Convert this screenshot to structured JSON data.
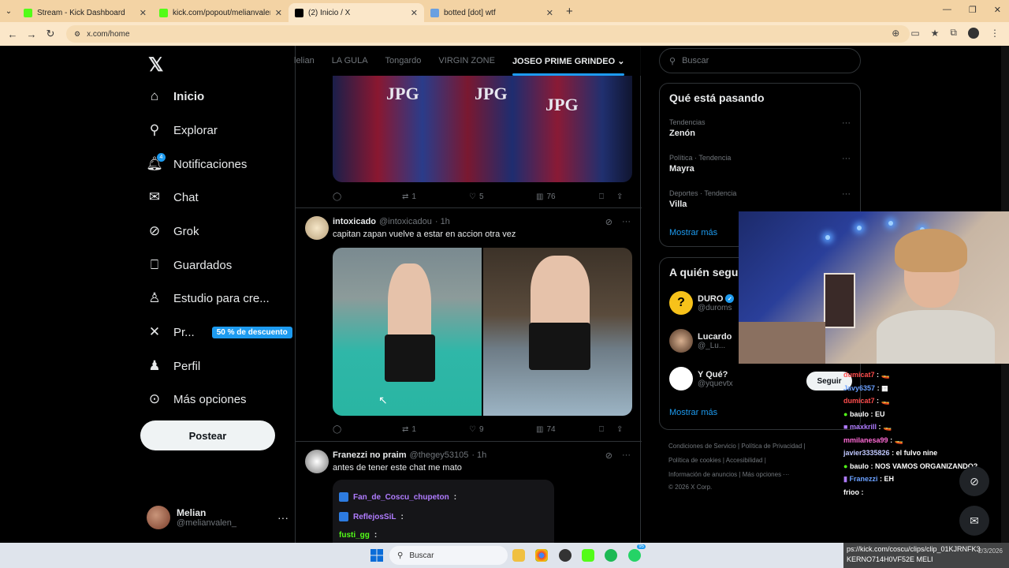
{
  "browser": {
    "tabs": [
      {
        "title": "Stream - Kick Dashboard",
        "favicon_color": "#53fc18"
      },
      {
        "title": "kick.com/popout/melianvalen/",
        "favicon_color": "#53fc18"
      },
      {
        "title": "(2) Inicio / X",
        "favicon_color": "#000000"
      },
      {
        "title": "botted [dot] wtf",
        "favicon_color": "#6aa0e0"
      }
    ],
    "new_tab": "+",
    "url": "x.com/home"
  },
  "nav": {
    "items": [
      {
        "label": "Inicio",
        "icon": "home-icon"
      },
      {
        "label": "Explorar",
        "icon": "search-icon"
      },
      {
        "label": "Notificaciones",
        "icon": "bell-icon",
        "badge": "4"
      },
      {
        "label": "Chat",
        "icon": "mail-icon"
      },
      {
        "label": "Grok",
        "icon": "grok-icon"
      },
      {
        "label": "Guardados",
        "icon": "bookmark-icon"
      },
      {
        "label": "Estudio para cre...",
        "icon": "studio-icon"
      },
      {
        "label": "Pr...",
        "icon": "x-premium-icon",
        "promo": "50 % de descuento"
      },
      {
        "label": "Perfil",
        "icon": "person-icon"
      },
      {
        "label": "Más opciones",
        "icon": "more-circle-icon"
      }
    ],
    "post_button": "Postear",
    "profile": {
      "name": "Melian",
      "handle": "@melianvalen_"
    }
  },
  "feed": {
    "tabs": [
      "lelian",
      "LA GULA",
      "Tongardo",
      "VIRGIN ZONE",
      "JOSEO PRIME GRINDEO"
    ],
    "active_tab": "JOSEO PRIME GRINDEO",
    "tweet0": {
      "image_text": "JPG",
      "replies": "",
      "retweets": "1",
      "likes": "5",
      "views": "76"
    },
    "tweet1": {
      "name": "intoxicado",
      "handle": "@intoxicadou",
      "time": "· 1h",
      "text": "capitan zapan vuelve a estar en accion otra vez",
      "retweets": "1",
      "likes": "9",
      "views": "74"
    },
    "tweet2": {
      "name": "Franezzi no praim",
      "handle": "@thegey53105",
      "time": "· 1h",
      "text": "antes de tener este chat me mato",
      "chat": [
        {
          "user": "Fan_de_Coscu_chupeton",
          "sep": ":",
          "color": "#b07cff"
        },
        {
          "user": "ReflejosSiL",
          "sep": ":",
          "color": "#b07cff"
        },
        {
          "user": "fusti_gg",
          "sep": ":",
          "color": "#53fc18"
        }
      ]
    }
  },
  "sidebar": {
    "search_placeholder": "Buscar",
    "trends_title": "Qué está pasando",
    "trends": [
      {
        "category": "Tendencias",
        "name": "Zenón"
      },
      {
        "category": "Política · Tendencia",
        "name": "Mayra"
      },
      {
        "category": "Deportes · Tendencia",
        "name": "Villa"
      }
    ],
    "show_more": "Mostrar más",
    "who_title": "A quién seguir",
    "who": [
      {
        "name": "DURO",
        "handle": "@duroms",
        "verified": true
      },
      {
        "name": "Lucardo",
        "handle": "@_Lu..."
      },
      {
        "name": "Y Qué?",
        "handle": "@yquevtx"
      }
    ],
    "follow_label": "Seguir",
    "who_more": "Mostrar más",
    "footer": [
      "Condiciones de Servicio",
      "Política de Privacidad",
      "Política de cookies",
      "Accesibilidad",
      "Información de anuncios",
      "Más opciones ···",
      "© 2026 X Corp."
    ]
  },
  "stream_chat": [
    {
      "user": "dumicat7",
      "msg": ":",
      "color": "#ff4d4d"
    },
    {
      "user": "Javy6357",
      "msg": ":",
      "color": "#6aa0ff"
    },
    {
      "user": "dumicat7",
      "msg": ":",
      "color": "#ff4d4d"
    },
    {
      "user": "baulo",
      "msg": ": EU",
      "color": "#ffffff"
    },
    {
      "user": "maxkrill",
      "msg": ":",
      "color": "#b07cff"
    },
    {
      "user": "mmilanesa99",
      "msg": ":",
      "color": "#ff6ad5"
    },
    {
      "user": "javier3335826",
      "msg": ": el fulvo nine",
      "color": "#c0c8ff"
    },
    {
      "user": "baulo",
      "msg": ": NOS VAMOS ORGANIZANDO?",
      "color": "#ffffff"
    },
    {
      "user": "Franezzi",
      "msg": ": EH",
      "color": "#6aa0ff"
    },
    {
      "user": "frioo",
      "msg": ":",
      "color": "#ffffff"
    }
  ],
  "clip": {
    "url": "ps://kick.com/coscu/clips/clip_01KJRNFK3",
    "url2": "KERNO714H0VF52E MELI",
    "date": "2/3/2026"
  },
  "taskbar": {
    "search": "Buscar",
    "badge": "95"
  }
}
